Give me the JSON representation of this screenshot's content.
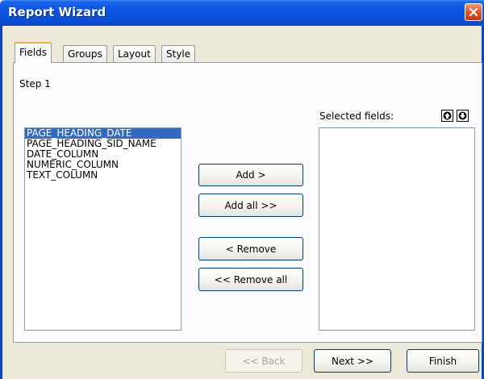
{
  "window": {
    "title": "Report Wizard"
  },
  "tabs": [
    {
      "label": "Fields",
      "active": true
    },
    {
      "label": "Groups",
      "active": false
    },
    {
      "label": "Layout",
      "active": false
    },
    {
      "label": "Style",
      "active": false
    }
  ],
  "step": {
    "label": "Step 1"
  },
  "available_fields": {
    "items": [
      "PAGE_HEADING_DATE",
      "PAGE_HEADING_SID_NAME",
      "DATE_COLUMN",
      "NUMERIC_COLUMN",
      "TEXT_COLUMN"
    ],
    "selected_index": 0
  },
  "transfer_buttons": {
    "add": "Add >",
    "add_all": "Add all >>",
    "remove": "< Remove",
    "remove_all": "<< Remove all"
  },
  "selected_fields": {
    "label": "Selected fields:",
    "items": []
  },
  "footer": {
    "back": "<< Back",
    "next": "Next >>",
    "finish": "Finish"
  },
  "colors": {
    "titlebar": "#0a55e0",
    "selection": "#316ac5",
    "active_tab_accent": "#f6b43c",
    "close_button": "#e2542a"
  },
  "icons": {
    "close": "close-icon",
    "move_up": "arrow-up-icon",
    "move_down": "arrow-down-icon"
  }
}
